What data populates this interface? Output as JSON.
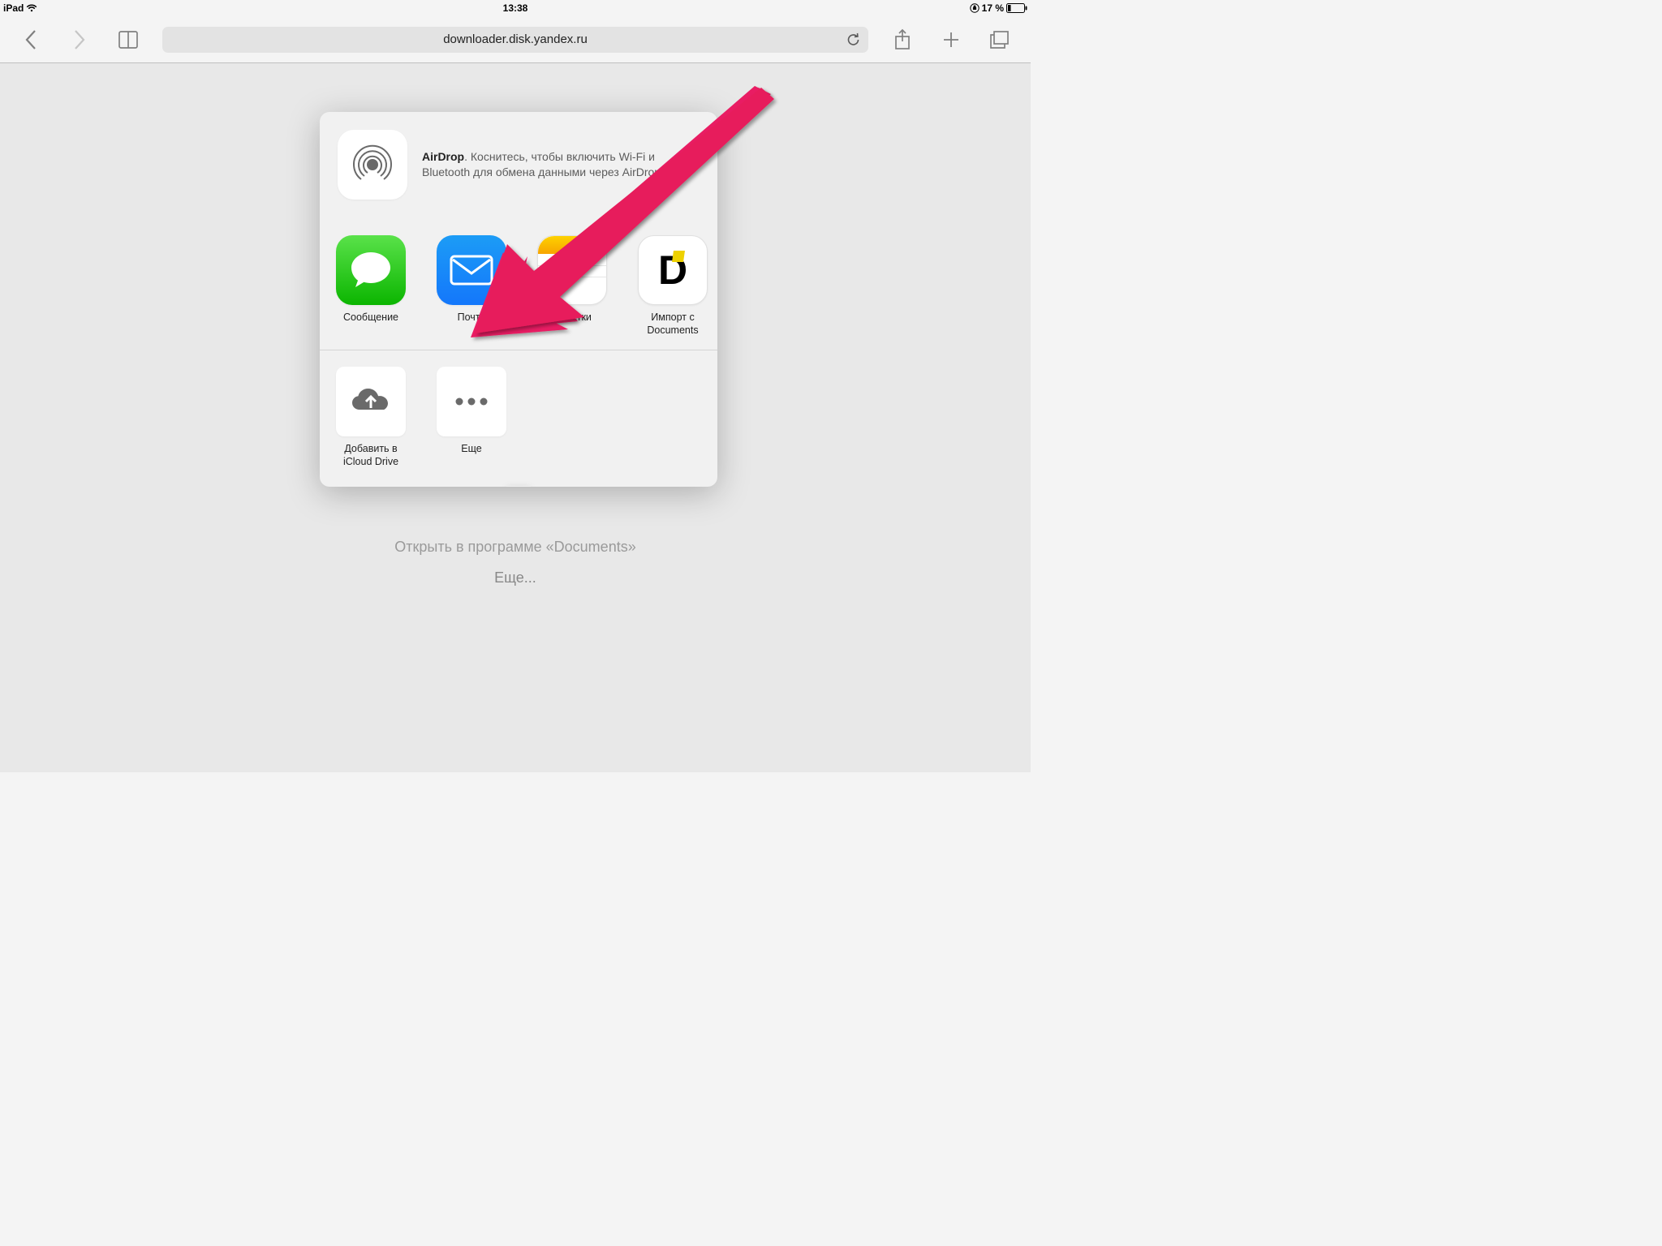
{
  "statusbar": {
    "device": "iPad",
    "time": "13:38",
    "battery_percent": "17 %"
  },
  "toolbar": {
    "url": "downloader.disk.yandex.ru"
  },
  "airdrop": {
    "title": "AirDrop",
    "desc": ". Коснитесь, чтобы включить Wi-Fi и Bluetooth для обмена данными через AirDrop."
  },
  "apps": [
    {
      "label": "Сообщение"
    },
    {
      "label": "Почта"
    },
    {
      "label": "Заметки"
    },
    {
      "label": "Импорт с Documents"
    }
  ],
  "actions": [
    {
      "label": "Добавить в iCloud Drive"
    },
    {
      "label": "Еще"
    }
  ],
  "background": {
    "line1": "Открыть в программе «Documents»",
    "line2": "Еще..."
  }
}
